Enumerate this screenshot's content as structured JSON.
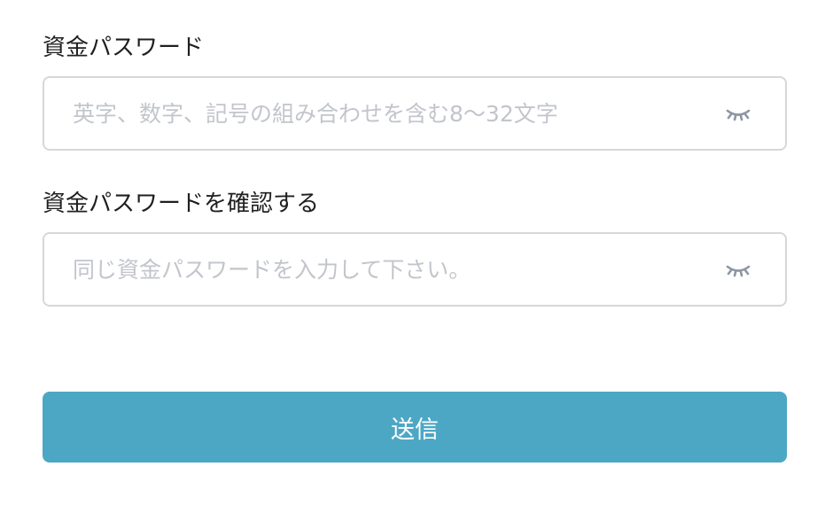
{
  "password": {
    "label": "資金パスワード",
    "placeholder": "英字、数字、記号の組み合わせを含む8〜32文字",
    "toggle_icon": "eye-closed-icon"
  },
  "confirm_password": {
    "label": "資金パスワードを確認する",
    "placeholder": "同じ資金パスワードを入力して下さい。",
    "toggle_icon": "eye-closed-icon"
  },
  "submit": {
    "label": "送信",
    "color": "#4ca7c5"
  },
  "colors": {
    "border": "#d5d7db",
    "placeholder": "#c2c5cb",
    "icon": "#8e96a3",
    "label": "#1f1f1f"
  }
}
